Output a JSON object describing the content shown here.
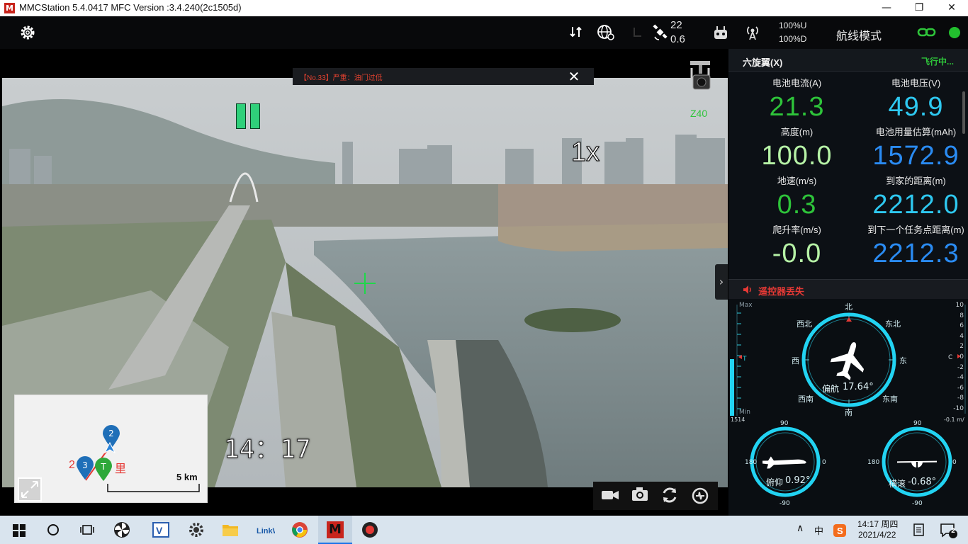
{
  "window": {
    "title": "MMCStation 5.4.0417 MFC Version :3.4.240(2c1505d)",
    "icon_letter": "M"
  },
  "topbar": {
    "satellites": "22",
    "hdop": "0.6",
    "link_up": "100%U",
    "link_down": "100%D",
    "mode": "航线模式"
  },
  "video": {
    "message": "【No.33】严重：油门过低",
    "zoom": "1x",
    "time": "14：17",
    "gimbal_label": "Z40"
  },
  "minimap": {
    "waypoint_2": "2",
    "waypoint_3": "3",
    "home": "T",
    "distance_text_prefix": "2",
    "distance_text_suffix": "里",
    "scale": "5 km"
  },
  "panel": {
    "vehicle": "六旋翼(X)",
    "flight_status": "飞行中...",
    "metrics": [
      {
        "label": "电池电流(A)",
        "value": "21.3",
        "color": "#2ec43a"
      },
      {
        "label": "电池电压(V)",
        "value": "49.9",
        "color": "#2ec8f0"
      },
      {
        "label": "高度(m)",
        "value": "100.0",
        "color": "#b6f2a6"
      },
      {
        "label": "电池用量估算(mAh)",
        "value": "1572.9",
        "color": "#2a8bf2"
      },
      {
        "label": "地速(m/s)",
        "value": "0.3",
        "color": "#2ec43a"
      },
      {
        "label": "到家的距离(m)",
        "value": "2212.0",
        "color": "#2ec8f0"
      },
      {
        "label": "爬升率(m/s)",
        "value": "-0.0",
        "color": "#b6f2a6"
      },
      {
        "label": "到下一个任务点距离(m)",
        "value": "2212.3",
        "color": "#2a8bf2"
      }
    ],
    "alarm": "遥控器丢失"
  },
  "instruments": {
    "compass": {
      "n": "北",
      "ne": "东北",
      "e": "东",
      "se": "东南",
      "s": "南",
      "sw": "西南",
      "w": "西",
      "nw": "西北",
      "yaw_label": "偏航",
      "yaw_value": "17.64°"
    },
    "left_scale": {
      "max": "Max",
      "min": "Min",
      "t": "T",
      "bottom": "1514"
    },
    "right_scale": {
      "ticks": [
        "10",
        "8",
        "6",
        "4",
        "2",
        "0",
        "-2",
        "-4",
        "-6",
        "-8",
        "-10"
      ],
      "c": "C",
      "bottom": "-0.1 m/"
    },
    "pitch": {
      "label": "俯仰",
      "value": "0.92°",
      "top": "90",
      "left": "180",
      "right": "0",
      "bottom": "-90"
    },
    "roll": {
      "label": "横滚",
      "value": "-0.68°",
      "top": "90",
      "left": "180",
      "right": "0",
      "bottom": "-90"
    }
  },
  "taskbar": {
    "time": "14:17 周四",
    "date": "2021/4/22",
    "ime": "中",
    "notifications": "2"
  },
  "colors": {
    "accent_green": "#2ec43a",
    "cyan": "#22d3f2",
    "blue": "#2a8bf2",
    "alarm_red": "#e53935"
  }
}
